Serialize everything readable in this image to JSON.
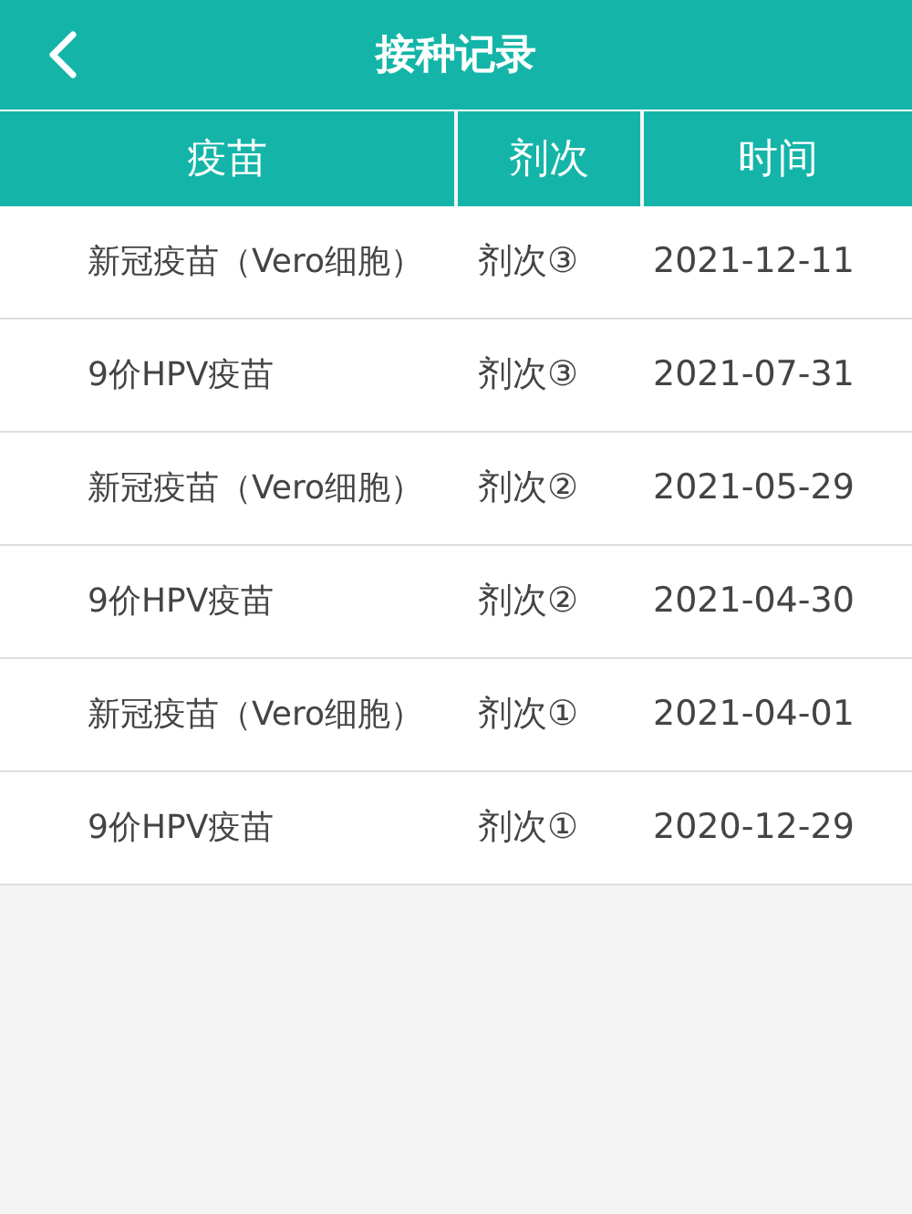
{
  "header": {
    "title": "接种记录"
  },
  "table": {
    "columns": [
      "疫苗",
      "剂次",
      "时间"
    ],
    "rows": [
      {
        "vaccine": "新冠疫苗（Vero细胞）",
        "dose": "剂次③",
        "time": "2021-12-11"
      },
      {
        "vaccine": "9价HPV疫苗",
        "dose": "剂次③",
        "time": "2021-07-31"
      },
      {
        "vaccine": "新冠疫苗（Vero细胞）",
        "dose": "剂次②",
        "time": "2021-05-29"
      },
      {
        "vaccine": "9价HPV疫苗",
        "dose": "剂次②",
        "time": "2021-04-30"
      },
      {
        "vaccine": "新冠疫苗（Vero细胞）",
        "dose": "剂次①",
        "time": "2021-04-01"
      },
      {
        "vaccine": "9价HPV疫苗",
        "dose": "剂次①",
        "time": "2020-12-29"
      }
    ]
  }
}
